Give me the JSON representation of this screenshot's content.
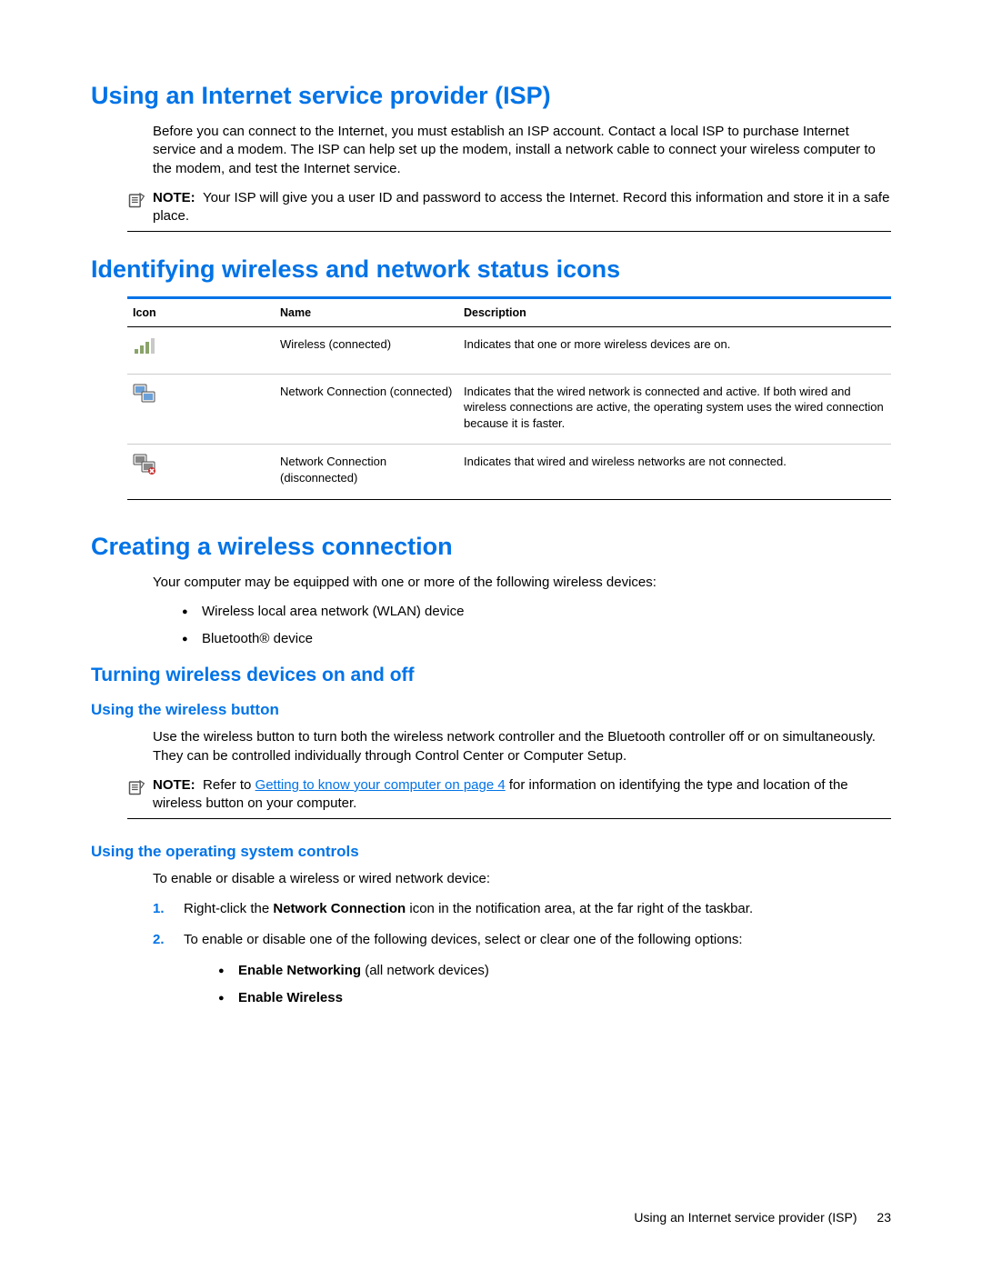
{
  "headings": {
    "isp": "Using an Internet service provider (ISP)",
    "identify": "Identifying wireless and network status icons",
    "create": "Creating a wireless connection",
    "turning": "Turning wireless devices on and off",
    "wireless_button": "Using the wireless button",
    "os_controls": "Using the operating system controls"
  },
  "paragraphs": {
    "isp_intro": "Before you can connect to the Internet, you must establish an ISP account. Contact a local ISP to purchase Internet service and a modem. The ISP can help set up the modem, install a network cable to connect your wireless computer to the modem, and test the Internet service.",
    "devices_intro": "Your computer may be equipped with one or more of the following wireless devices:",
    "wireless_button_intro": "Use the wireless button to turn both the wireless network controller and the Bluetooth controller off or on simultaneously. They can be controlled individually through Control Center or Computer Setup.",
    "os_intro": "To enable or disable a wireless or wired network device:"
  },
  "notes": {
    "label": "NOTE:",
    "isp_note": "Your ISP will give you a user ID and password to access the Internet. Record this information and store it in a safe place.",
    "wireless_note_before": "Refer to ",
    "wireless_note_link": "Getting to know your computer on page 4",
    "wireless_note_after": " for information on identifying the type and location of the wireless button on your computer."
  },
  "table": {
    "headers": {
      "icon": "Icon",
      "name": "Name",
      "desc": "Description"
    },
    "rows": [
      {
        "name": "Wireless (connected)",
        "desc": "Indicates that one or more wireless devices are on."
      },
      {
        "name": "Network Connection (connected)",
        "desc": "Indicates that the wired network is connected and active. If both wired and wireless connections are active, the operating system uses the wired connection because it is faster."
      },
      {
        "name": "Network Connection (disconnected)",
        "desc": "Indicates that wired and wireless networks are not connected."
      }
    ]
  },
  "bullets": {
    "devices": [
      "Wireless local area network (WLAN) device",
      "Bluetooth® device"
    ],
    "options": [
      {
        "bold": "Enable Networking",
        "rest": " (all network devices)"
      },
      {
        "bold": "Enable Wireless",
        "rest": ""
      }
    ]
  },
  "steps": {
    "s1_a": "Right-click the ",
    "s1_bold": "Network Connection",
    "s1_b": " icon in the notification area, at the far right of the taskbar.",
    "s2": "To enable or disable one of the following devices, select or clear one of the following options:"
  },
  "footer": {
    "title": "Using an Internet service provider (ISP)",
    "page": "23"
  }
}
